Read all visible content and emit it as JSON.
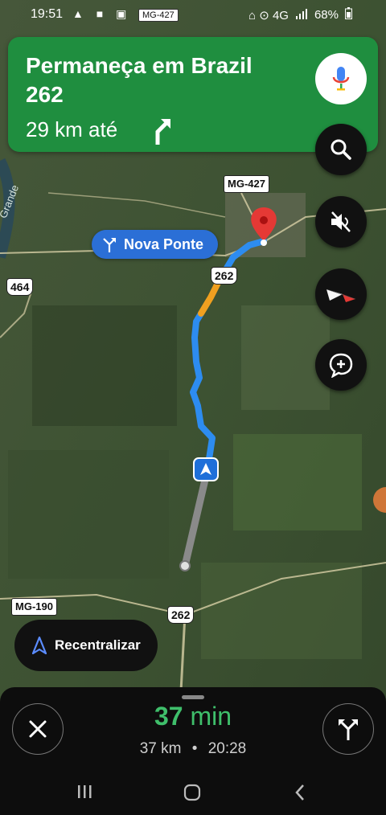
{
  "status_bar": {
    "time": "19:51",
    "left_icons": "▲ ■ ▣ •",
    "road_chip": "MG-427",
    "right_icons": "⌂ ⊙ 4G",
    "battery": "68%"
  },
  "banner": {
    "title": "Permaneça em Brazil 262",
    "distance": "29 km até",
    "color": "#1f8e3f"
  },
  "map": {
    "shields": {
      "mg427": "MG-427",
      "r262_top": "262",
      "r464": "464",
      "mg190": "MG-190",
      "r262_bottom": "262"
    },
    "water_label": "Grande",
    "place_label": "Nova Ponte",
    "route_color": "#2d8cf0",
    "traffic_color": "#f0a020"
  },
  "recenter": {
    "label": "Recentralizar"
  },
  "trip": {
    "eta_minutes": "37",
    "eta_unit": "min",
    "distance": "37 km",
    "separator": "•",
    "arrival": "20:28"
  },
  "icons": {
    "mic": "mic-icon",
    "search": "search-icon",
    "mute": "volume-off-icon",
    "compass": "compass-icon",
    "report": "add-report-icon",
    "close": "close-icon",
    "alternate": "fork-route-icon"
  }
}
